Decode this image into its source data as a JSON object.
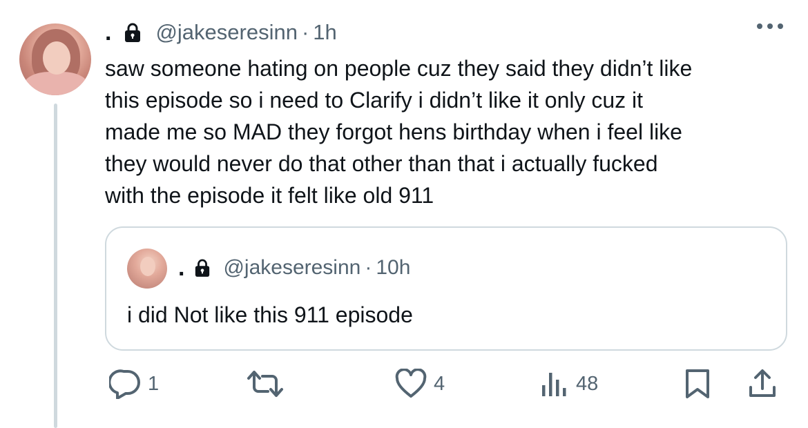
{
  "tweet": {
    "display_name": ".",
    "handle": "@jakeseresinn",
    "separator": "·",
    "time": "1h",
    "text": "saw someone hating on people cuz they said they didn’t like\nthis episode so i need to Clarify i didn’t like it only cuz it\nmade me so MAD they forgot hens birthday when i feel like\nthey would never do that other than that i actually fucked\nwith the episode it felt like old 911"
  },
  "quoted": {
    "display_name": ".",
    "handle": "@jakeseresinn",
    "separator": "·",
    "time": "10h",
    "text": "i did Not like this 911 episode"
  },
  "actions": {
    "reply_count": "1",
    "retweet_count": "",
    "like_count": "4",
    "views_count": "48"
  },
  "icons": {
    "lock": "lock-icon",
    "more": "more-icon",
    "reply": "reply-icon",
    "retweet": "retweet-icon",
    "like": "heart-icon",
    "views": "views-icon",
    "bookmark": "bookmark-icon",
    "share": "share-icon"
  },
  "colors": {
    "text": "#0f1419",
    "secondary": "#536471",
    "border": "#cfd9de"
  }
}
